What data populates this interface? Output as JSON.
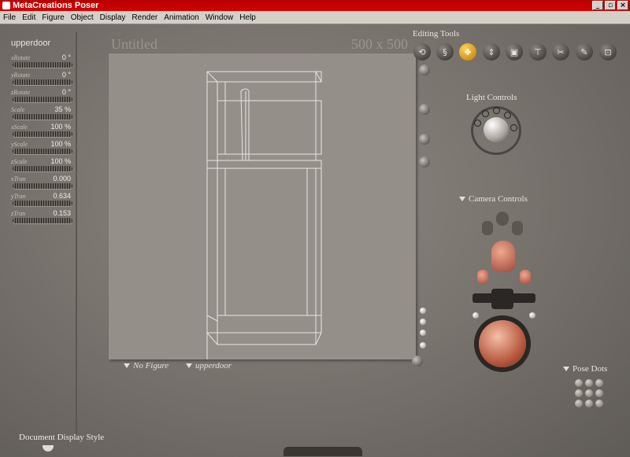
{
  "window": {
    "title": "MetaCreations Poser",
    "minimize": "_",
    "maximize": "▫",
    "close": "×"
  },
  "menu": [
    "File",
    "Edit",
    "Figure",
    "Object",
    "Display",
    "Render",
    "Animation",
    "Window",
    "Help"
  ],
  "left_panel": {
    "actor": "upperdoor",
    "params": [
      {
        "label": "xRotate",
        "value": "0 °"
      },
      {
        "label": "yRotate",
        "value": "0 °"
      },
      {
        "label": "zRotate",
        "value": "0 °"
      },
      {
        "label": "Scale",
        "value": "35 %"
      },
      {
        "label": "xScale",
        "value": "100 %"
      },
      {
        "label": "yScale",
        "value": "100 %"
      },
      {
        "label": "zScale",
        "value": "100 %"
      },
      {
        "label": "xTran",
        "value": "0.000"
      },
      {
        "label": "yTran",
        "value": "0.634"
      },
      {
        "label": "zTran",
        "value": "0.153"
      }
    ]
  },
  "document": {
    "title": "Untitled",
    "size": "500 x 500",
    "figure_menu": "No Figure",
    "actor_menu": "upperdoor"
  },
  "editing_tools": {
    "label": "Editing Tools",
    "tools": [
      {
        "icon": "rotate-icon",
        "glyph": "⟲"
      },
      {
        "icon": "twist-icon",
        "glyph": "§"
      },
      {
        "icon": "translate-icon",
        "glyph": "✥"
      },
      {
        "icon": "translate-in-out-icon",
        "glyph": "⇕"
      },
      {
        "icon": "scale-icon",
        "glyph": "▣"
      },
      {
        "icon": "taper-icon",
        "glyph": "⊤"
      },
      {
        "icon": "chain-break-icon",
        "glyph": "✂"
      },
      {
        "icon": "color-icon",
        "glyph": "✎"
      },
      {
        "icon": "view-magnifier-icon",
        "glyph": "⊡"
      }
    ],
    "active_tool": "translate-icon"
  },
  "light_controls": {
    "label": "Light Controls"
  },
  "camera_controls": {
    "label": "Camera Controls"
  },
  "pose_dots": {
    "label": "Pose Dots"
  },
  "footer": {
    "label": "Document Display Style"
  }
}
